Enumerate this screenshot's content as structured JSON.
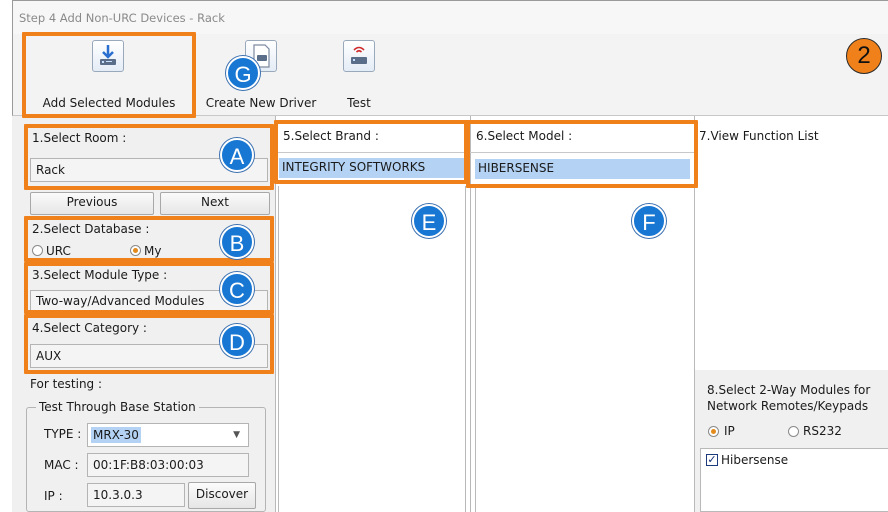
{
  "window": {
    "title": "Step 4 Add Non-URC Devices - Rack"
  },
  "toolbar": {
    "add_selected_modules": "Add Selected Modules",
    "create_new_driver": "Create New Driver",
    "test": "Test"
  },
  "step_badge": "2",
  "callouts": {
    "a": "A",
    "b": "B",
    "c": "C",
    "d": "D",
    "e": "E",
    "f": "F",
    "g": "G"
  },
  "left": {
    "room_label": "1.Select Room :",
    "room_value": "Rack",
    "previous": "Previous",
    "next": "Next",
    "database_label": "2.Select Database :",
    "database_options": [
      "URC",
      "My"
    ],
    "database_selected": "My",
    "module_type_label": "3.Select Module Type :",
    "module_type_value": "Two-way/Advanced Modules",
    "category_label": "4.Select Category :",
    "category_value": "AUX",
    "testing_label": "For testing :",
    "base_station_group": "Test Through Base Station",
    "type_label": "TYPE :",
    "type_value": "MRX-30",
    "mac_label": "MAC :",
    "mac_value": "00:1F:B8:03:00:03",
    "ip_label": "IP :",
    "ip_value": "10.3.0.3",
    "discover": "Discover"
  },
  "brand": {
    "label": "5.Select Brand :",
    "selected": "INTEGRITY SOFTWORKS"
  },
  "model": {
    "label": "6.Select Model :",
    "selected": "HIBERSENSE"
  },
  "function_list": {
    "label": "7.View Function List"
  },
  "twoway": {
    "label_line1": "8.Select 2-Way Modules for",
    "label_line2": "Network Remotes/Keypads",
    "options": [
      "IP",
      "RS232"
    ],
    "selected": "IP",
    "items": [
      {
        "label": "Hibersense",
        "checked": true
      }
    ]
  },
  "colors": {
    "accent_orange": "#f0811a",
    "callout_blue": "#1877d3",
    "selection_blue": "#b4d3f4"
  }
}
